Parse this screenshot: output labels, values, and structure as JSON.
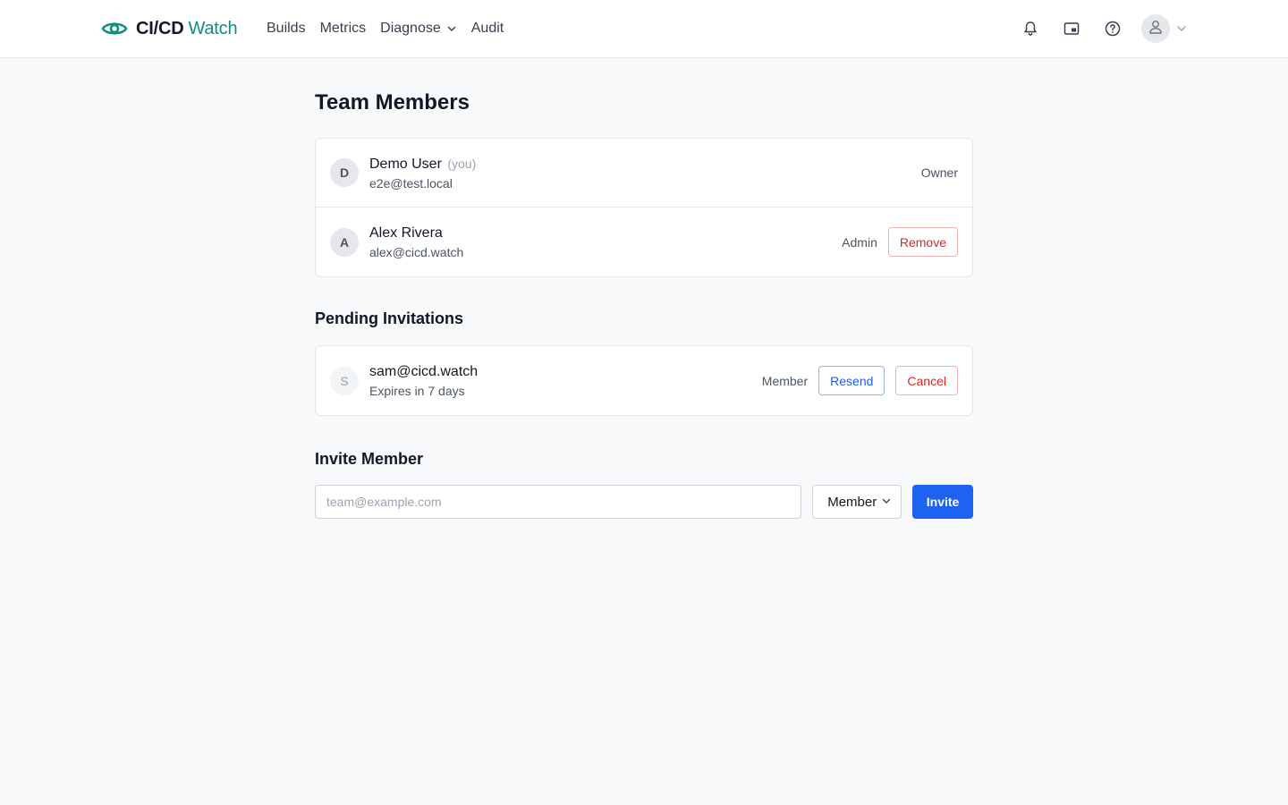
{
  "header": {
    "brand_primary": "CI/CD",
    "brand_secondary": "Watch",
    "nav": [
      {
        "label": "Builds"
      },
      {
        "label": "Metrics"
      },
      {
        "label": "Diagnose"
      },
      {
        "label": "Audit"
      }
    ],
    "icons": [
      "bell-icon",
      "picture-in-picture-icon",
      "help-icon",
      "user-icon",
      "chevron-down-icon"
    ]
  },
  "page": {
    "title": "Team Members"
  },
  "members": [
    {
      "initial": "D",
      "name": "Demo User",
      "you_tag": "(you)",
      "email": "e2e@test.local",
      "role": "Owner"
    },
    {
      "initial": "A",
      "name": "Alex Rivera",
      "email": "alex@cicd.watch",
      "role": "Admin",
      "remove_label": "Remove"
    }
  ],
  "pending": {
    "title": "Pending Invitations",
    "items": [
      {
        "initial": "S",
        "email": "sam@cicd.watch",
        "expires": "Expires in 7 days",
        "role": "Member",
        "resend_label": "Resend",
        "cancel_label": "Cancel"
      }
    ]
  },
  "invite": {
    "title": "Invite Member",
    "email_placeholder": "team@example.com",
    "email_value": "",
    "role_selected": "Member",
    "submit_label": "Invite"
  },
  "colors": {
    "brand_accent": "#0f8f7a",
    "primary": "#1d63f0",
    "danger": "#dc2626",
    "background": "#f8f9fb"
  }
}
